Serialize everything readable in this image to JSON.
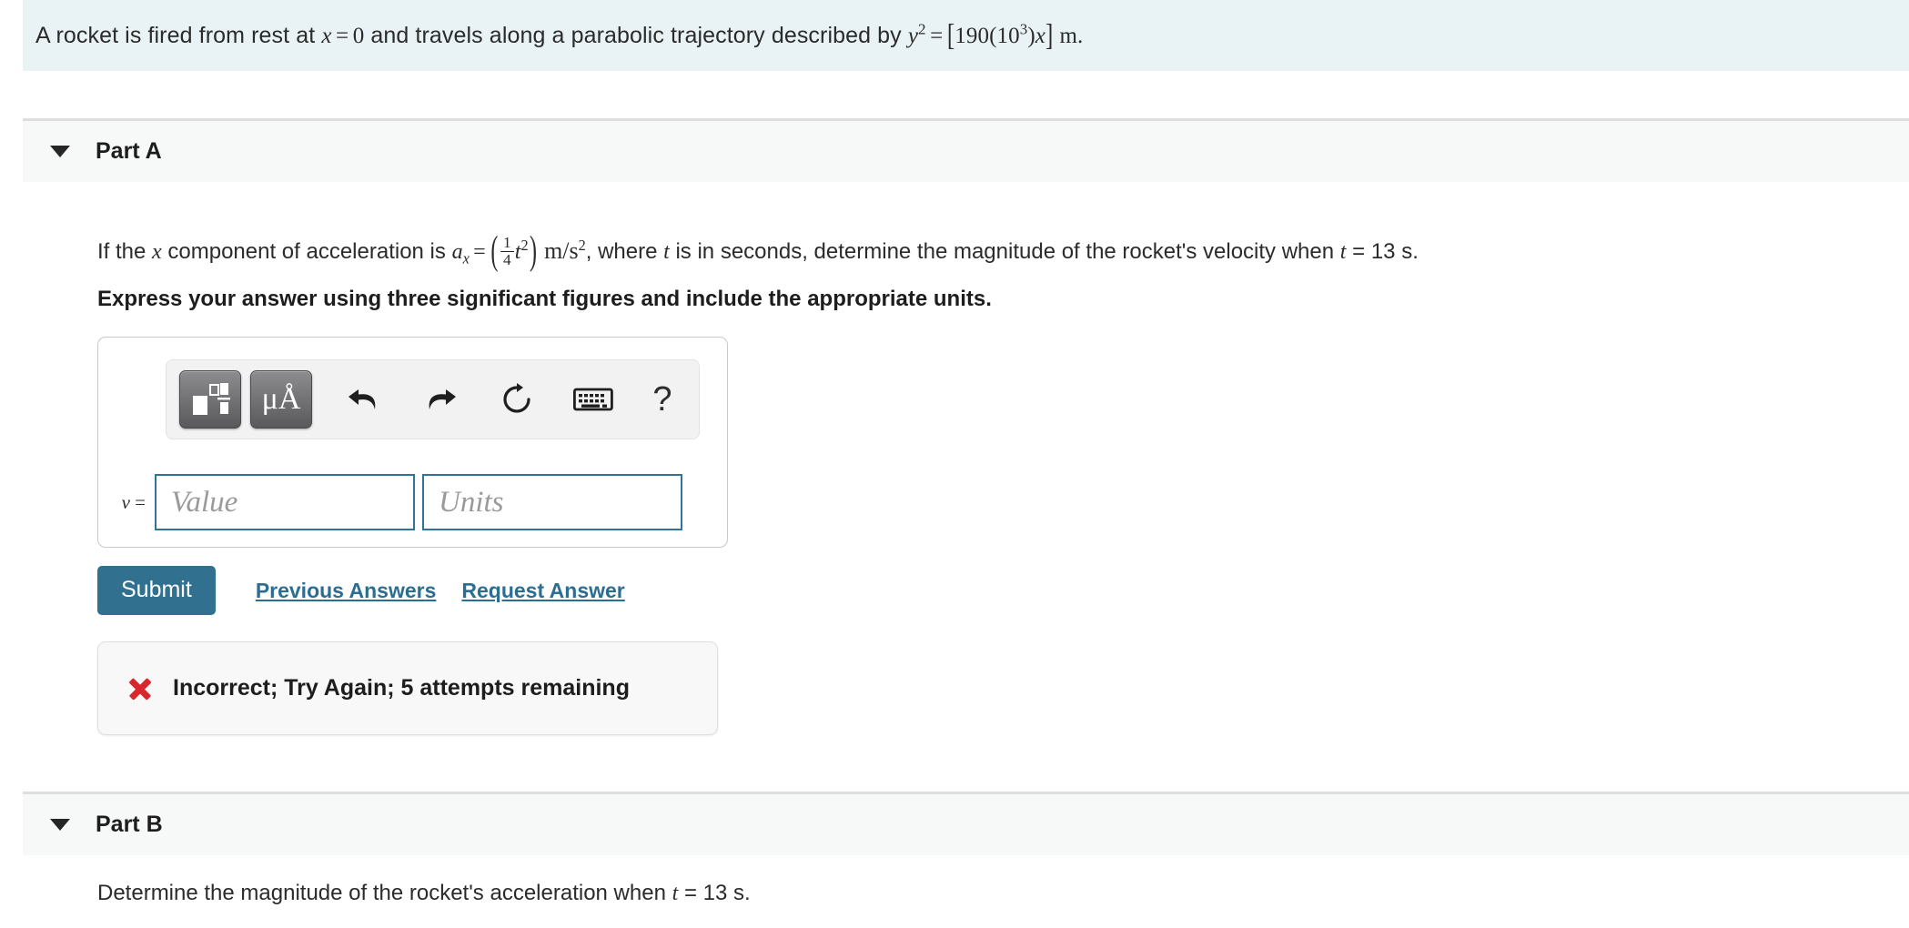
{
  "problem": {
    "statement_plain": "A rocket is fired from rest at x = 0 and travels along a parabolic trajectory described by y^2 = [190(10^3)x] m.",
    "lead_in": "A rocket is fired from rest at",
    "x_var": "x",
    "equals": "=",
    "zero": "0",
    "mid": "and travels along a parabolic trajectory described by",
    "y_var": "y",
    "y_exp": "2",
    "coef": "190(10",
    "coef_exp": "3",
    "coef_tail": ")",
    "unit_m": "m."
  },
  "parts": [
    {
      "id": "part-a",
      "title": "Part A",
      "caret": "chevron-down-icon",
      "question": {
        "seg1": "If the",
        "var_x": "x",
        "seg2": "component of acceleration is",
        "a_sym": "a",
        "a_sub": "x",
        "eq": "=",
        "frac_num": "1",
        "frac_den": "4",
        "t_sym": "t",
        "t_exp": "2",
        "units": "m/s",
        "units_exp": "2",
        "seg3": ", where",
        "t_var": "t",
        "seg4": "is in seconds, determine the magnitude of the rocket's velocity when",
        "t_var2": "t",
        "eq2": "=",
        "t_value": "13",
        "t_unit": "s."
      },
      "instruction": "Express your answer using three significant figures and include the appropriate units.",
      "answer_area": {
        "toolbar": {
          "buttons": [
            {
              "name": "math-template-button",
              "label": "",
              "icon": "math-template-icon",
              "active": true
            },
            {
              "name": "units-button",
              "label": "μÅ",
              "icon": "micro-angstrom-icon",
              "active": true
            },
            {
              "name": "undo-button",
              "label": "",
              "icon": "undo-arrow-icon",
              "active": false
            },
            {
              "name": "redo-button",
              "label": "",
              "icon": "redo-arrow-icon",
              "active": false
            },
            {
              "name": "reset-button",
              "label": "",
              "icon": "reset-circular-arrow-icon",
              "active": false
            },
            {
              "name": "keyboard-button",
              "label": "",
              "icon": "keyboard-icon",
              "active": false
            },
            {
              "name": "help-button",
              "label": "?",
              "icon": "question-mark-icon",
              "active": false
            }
          ]
        },
        "variable_label": "v",
        "variable_equals": "=",
        "value_input": {
          "value": "",
          "placeholder": "Value"
        },
        "units_input": {
          "value": "",
          "placeholder": "Units"
        }
      },
      "actions": {
        "submit_label": "Submit",
        "previous_answers_label": "Previous Answers",
        "request_answer_label": "Request Answer"
      },
      "feedback": {
        "icon": "red-x-icon",
        "text": "Incorrect; Try Again; 5 attempts remaining",
        "attempts_remaining": "5"
      }
    },
    {
      "id": "part-b",
      "title": "Part B",
      "caret": "chevron-down-icon",
      "question": {
        "seg1": "Determine the magnitude of the rocket's acceleration when",
        "t_var": "t",
        "eq": "=",
        "t_value": "13",
        "t_unit": "s."
      }
    }
  ],
  "colors": {
    "banner_bg": "#e9f3f5",
    "part_header_bg": "#f7f8f8",
    "accent_blue": "#31708f",
    "link_blue": "#2b6e91",
    "error_red": "#d9272e",
    "input_border": "#30749b",
    "page_bg": "#ffffff"
  }
}
